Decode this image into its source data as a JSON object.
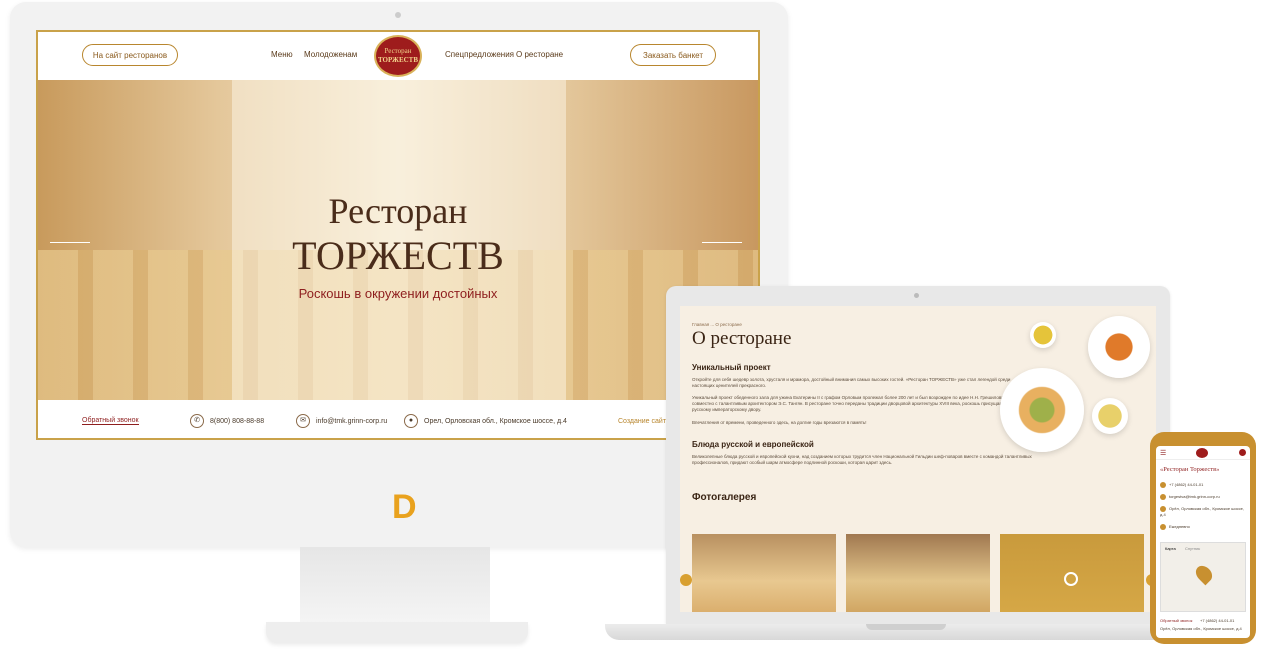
{
  "monitor": {
    "header": {
      "left_button": "На сайт ресторанов",
      "nav": [
        "Меню",
        "Молодоженам",
        "Спецпредложения",
        "О ресторане"
      ],
      "logo_line1": "Ресторан",
      "logo_line2": "ТОРЖЕСТВ",
      "right_button": "Заказать банкет"
    },
    "hero": {
      "title_line1": "Ресторан",
      "title_line2": "ТОРЖЕСТВ",
      "subtitle": "Роскошь в окружении достойных"
    },
    "footer": {
      "callback": "Обратный звонок",
      "phone": "8(800) 808-88-88",
      "email": "info@tmk.grinn-corp.ru",
      "address": "Орел, Орловская обл., Кромское шоссе, д.4",
      "credit": "Создание сайта"
    }
  },
  "brand_mark": "D",
  "laptop": {
    "breadcrumb": "Главная ... О ресторане",
    "page_title": "О ресторане",
    "section1_title": "Уникальный проект",
    "section1_text": "Откройте для себя шедевр золота, хрусталя и мрамора, достойный внимания самых высоких гостей. «Ресторан ТОРЖЕСТВ» уже стал легендой среди настоящих ценителей прекрасного.",
    "section1_text2": "Уникальный проект обеденного зала для ужина Екатерины II с графом Орловым пролежал более 200 лет и был возрожден по идее Н.Н. Грешилова совместно с талантливым архитектором Э.С. Тангян. В ресторане точно переданы традиции дворцовой архитектуры XVIII века, роскошь присущая русскому императорскому двору.",
    "section1_text3": "Впечатления от времени, проведенного здесь, на долгие годы врезаются в память!",
    "section2_title": "Блюда русской и европейской",
    "section2_text": "Великолепные блюда русской и европейской кухни, над созданием которых трудится член Национальной Гильдии шеф-поваров вместе с командой талантливых профессионалов, придают особый шарм атмосфере подлинной роскоши, которая царит здесь.",
    "gallery_title": "Фотогалерея"
  },
  "phone": {
    "title": "«Ресторан Торжеств»",
    "phone": "+7 (4862) 44-01-01",
    "email": "torgestva@tmk.grinn-corp.ru",
    "address": "Орёл, Орловская обл., Кромское шоссе, д.4",
    "hours": "Ежедневно",
    "map_tabs": [
      "Карта",
      "Спутник"
    ],
    "callback": "Обратный звонок",
    "footer_phone": "+7 (4862) 44-01-01",
    "footer_address": "Орёл, Орловская обл., Кромское шоссе, д.4"
  }
}
